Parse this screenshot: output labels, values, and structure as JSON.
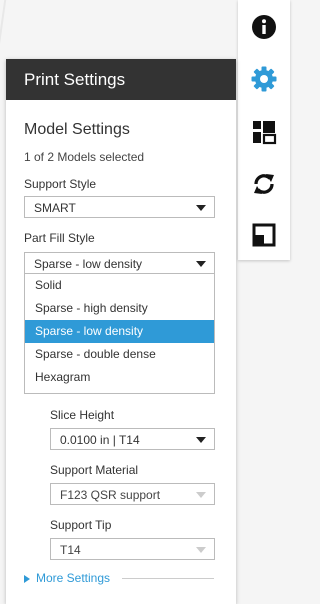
{
  "panel": {
    "title": "Print Settings",
    "section_title": "Model Settings",
    "models_selected": "1 of 2 Models selected"
  },
  "support_style": {
    "label": "Support Style",
    "value": "SMART"
  },
  "part_fill": {
    "label": "Part Fill Style",
    "value": "Sparse - low density",
    "options": [
      "Solid",
      "Sparse - high density",
      "Sparse - low density",
      "Sparse - double dense",
      "Hexagram"
    ],
    "selected_index": 2
  },
  "slice_height": {
    "label": "Slice Height",
    "value": "0.0100 in | T14"
  },
  "support_material": {
    "label": "Support Material",
    "value": "F123 QSR support"
  },
  "support_tip": {
    "label": "Support Tip",
    "value": "T14"
  },
  "more_settings": "More Settings",
  "toolbar": {
    "icons": [
      "info-icon",
      "gear-icon",
      "layout-icon",
      "rotate-icon",
      "scale-icon"
    ],
    "active": "gear-icon",
    "active_color": "#2f9ad7"
  }
}
